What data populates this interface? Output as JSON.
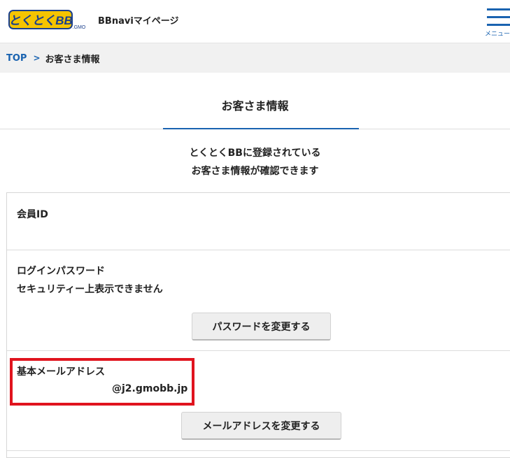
{
  "header": {
    "logo_text": "とくとくBB",
    "logo_sub": ".GMO",
    "app_title": "BBnaviマイページ",
    "menu_label": "メニュー"
  },
  "breadcrumb": {
    "home": "TOP",
    "current": "お客さま情報"
  },
  "page": {
    "title": "お客さま情報",
    "intro_line1": "とくとくBBに登録されている",
    "intro_line2": "お客さま情報が確認できます"
  },
  "fields": {
    "member_id": {
      "label": "会員ID",
      "value": ""
    },
    "login_password": {
      "label": "ログインパスワード",
      "value": "セキュリティー上表示できません",
      "button": "パスワードを変更する"
    },
    "email": {
      "label": "基本メールアドレス",
      "value": "@j2.gmobb.jp",
      "button": "メールアドレスを変更する"
    }
  },
  "colors": {
    "accent": "#1a63b0",
    "highlight": "#e0141e",
    "logo_yellow": "#f5c400"
  }
}
